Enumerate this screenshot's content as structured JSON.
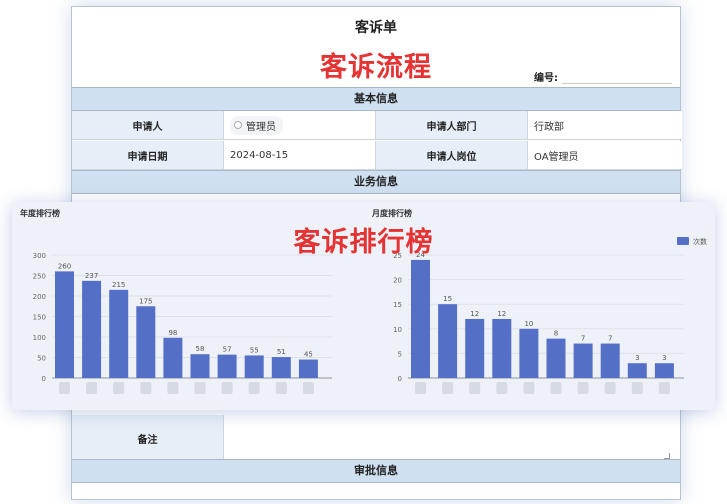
{
  "form": {
    "title": "客诉单",
    "overlay": "客诉流程",
    "serial_label": "编号:",
    "sections": {
      "basic": "基本信息",
      "business": "业务信息",
      "approval": "审批信息"
    },
    "fields": {
      "applicant_label": "申请人",
      "applicant_value": "管理员",
      "dept_label": "申请人部门",
      "dept_value": "行政部",
      "date_label": "申请日期",
      "date_value": "2024-08-15",
      "post_label": "申请人岗位",
      "post_value": "OA管理员",
      "remark_label": "备注"
    }
  },
  "charts": {
    "overlay": "客诉排行榜",
    "accent": "#5470c6"
  },
  "chart_data": [
    {
      "type": "bar",
      "title": "年度排行榜",
      "categories": [
        "",
        "",
        "",
        "",
        "",
        "",
        "",
        "",
        "",
        ""
      ],
      "values": [
        260,
        237,
        215,
        175,
        98,
        58,
        57,
        55,
        51,
        45
      ],
      "ylim": [
        0,
        300
      ],
      "yticks": [
        0,
        50,
        100,
        150,
        200,
        250,
        300
      ]
    },
    {
      "type": "bar",
      "title": "月度排行榜",
      "categories": [
        "",
        "",
        "",
        "",
        "",
        "",
        "",
        "",
        "",
        ""
      ],
      "series": [
        {
          "name": "次数",
          "values": [
            24,
            15,
            12,
            12,
            10,
            8,
            7,
            7,
            3,
            3
          ]
        }
      ],
      "ylim": [
        0,
        25
      ],
      "yticks": [
        0,
        5,
        10,
        15,
        20,
        25
      ],
      "legend": "top-right"
    }
  ]
}
